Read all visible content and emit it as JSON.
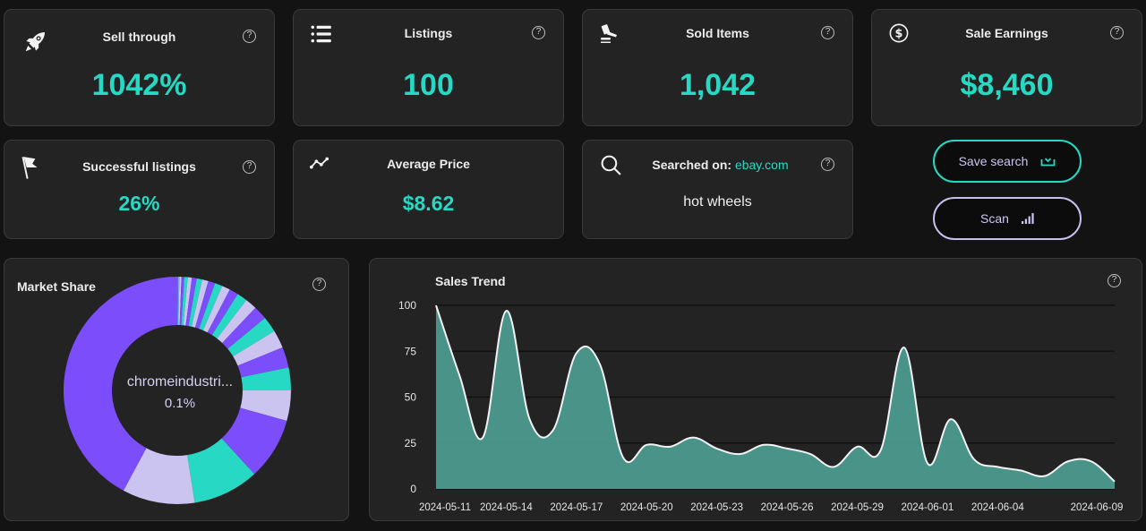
{
  "kpis": {
    "sell_through": {
      "title": "Sell through",
      "value": "1042%",
      "icon": "rocket-icon"
    },
    "listings": {
      "title": "Listings",
      "value": "100",
      "icon": "list-icon"
    },
    "sold_items": {
      "title": "Sold Items",
      "value": "1,042",
      "icon": "gavel-icon"
    },
    "sale_earnings": {
      "title": "Sale Earnings",
      "value": "$8,460",
      "icon": "dollar-icon"
    },
    "successful_listings": {
      "title": "Successful listings",
      "value": "26%",
      "icon": "flag-icon"
    },
    "average_price": {
      "title": "Average Price",
      "value": "$8.62",
      "icon": "trend-line-icon"
    }
  },
  "search": {
    "label": "Searched on:",
    "site": "ebay.com",
    "query": "hot wheels",
    "icon": "search-icon"
  },
  "help_glyph": "?",
  "buttons": {
    "save_search": "Save search",
    "scan": "Scan"
  },
  "colors": {
    "accent_teal": "#27d9c4",
    "purple": "#7b4dfb",
    "lavender": "#cbc3f0",
    "area_fill": "#4d9a8e",
    "background": "#131313",
    "card": "#232323"
  },
  "market_share": {
    "title": "Market Share",
    "center_label": "chromeindustri...",
    "center_value": "0.1%"
  },
  "sales_trend": {
    "title": "Sales Trend"
  },
  "chart_data": [
    {
      "type": "pie",
      "title": "Market Share",
      "donut": true,
      "highlighted": {
        "label": "chromeindustri...",
        "value_pct": 0.1
      },
      "slices_pct": [
        0.1,
        0.2,
        0.3,
        0.4,
        0.5,
        0.6,
        0.7,
        0.8,
        0.9,
        1.0,
        1.1,
        1.2,
        1.3,
        1.5,
        1.7,
        2.0,
        2.3,
        2.6,
        3.0,
        3.3,
        4.4,
        9.0,
        9.6,
        10.5,
        43.0
      ],
      "slice_colors_cycle": [
        "#7b4dfb",
        "#27d9c4",
        "#cbc3f0"
      ],
      "dominant_color": "#7b4dfb"
    },
    {
      "type": "area",
      "title": "Sales Trend",
      "xlabel": "",
      "ylabel": "",
      "ylim": [
        0,
        100
      ],
      "yticks": [
        0,
        25,
        50,
        75,
        100
      ],
      "grid": true,
      "x": [
        "2024-05-11",
        "2024-05-12",
        "2024-05-13",
        "2024-05-14",
        "2024-05-15",
        "2024-05-16",
        "2024-05-17",
        "2024-05-18",
        "2024-05-19",
        "2024-05-20",
        "2024-05-21",
        "2024-05-22",
        "2024-05-23",
        "2024-05-24",
        "2024-05-25",
        "2024-05-26",
        "2024-05-27",
        "2024-05-28",
        "2024-05-29",
        "2024-05-30",
        "2024-05-31",
        "2024-06-01",
        "2024-06-02",
        "2024-06-03",
        "2024-06-04",
        "2024-06-05",
        "2024-06-06",
        "2024-06-07",
        "2024-06-08",
        "2024-06-09"
      ],
      "xtick_labels": [
        "2024-05-11",
        "2024-05-14",
        "2024-05-17",
        "2024-05-20",
        "2024-05-23",
        "2024-05-26",
        "2024-05-29",
        "2024-06-01",
        "2024-06-04",
        "2024-06-09"
      ],
      "series": [
        {
          "name": "Sales",
          "values": [
            100,
            62,
            28,
            97,
            38,
            32,
            74,
            68,
            17,
            24,
            23,
            28,
            22,
            19,
            24,
            22,
            19,
            12,
            23,
            21,
            77,
            14,
            38,
            16,
            12,
            10,
            7,
            15,
            15,
            4
          ]
        }
      ]
    }
  ]
}
